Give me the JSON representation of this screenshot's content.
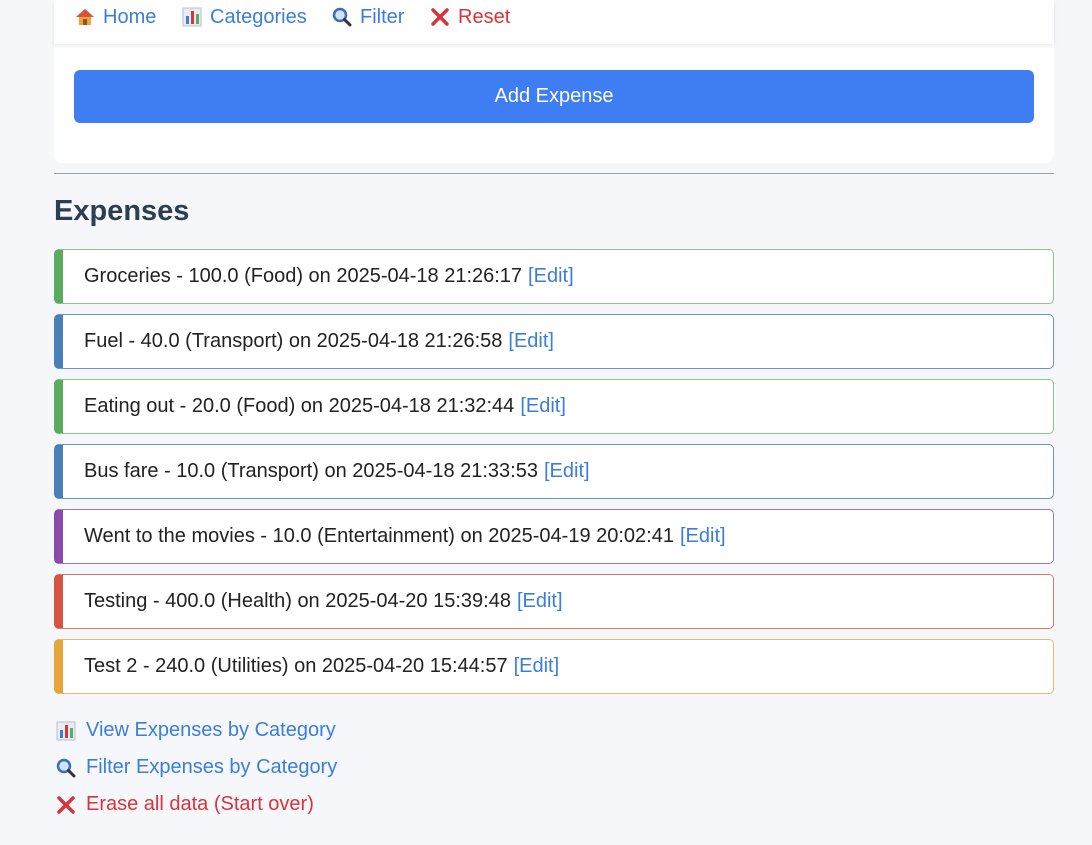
{
  "nav": {
    "items": [
      {
        "label": "Home",
        "icon": "house-icon",
        "color": "#3b7ddd"
      },
      {
        "label": "Categories",
        "icon": "bar-chart-icon",
        "color": "#3b7ddd"
      },
      {
        "label": "Filter",
        "icon": "magnifier-icon",
        "color": "#3b7ddd"
      },
      {
        "label": "Reset",
        "icon": "cross-icon",
        "color": "#d8343a"
      }
    ]
  },
  "add_button": {
    "label": "Add Expense",
    "color": "#3f7ef2"
  },
  "section": {
    "title": "Expenses"
  },
  "expenses": [
    {
      "text": "Groceries - 100.0 (Food) on 2025-04-18 21:26:17",
      "edit": "[Edit]",
      "category": "Food",
      "accent": "#5aab5e",
      "border": "#8cc58f"
    },
    {
      "text": "Fuel - 40.0 (Transport) on 2025-04-18 21:26:58",
      "edit": "[Edit]",
      "category": "Transport",
      "accent": "#4a7fba",
      "border": "#6b93c4"
    },
    {
      "text": "Eating out - 20.0 (Food) on 2025-04-18 21:32:44",
      "edit": "[Edit]",
      "category": "Food",
      "accent": "#5aab5e",
      "border": "#8cc58f"
    },
    {
      "text": "Bus fare - 10.0 (Transport) on 2025-04-18 21:33:53",
      "edit": "[Edit]",
      "category": "Transport",
      "accent": "#4a7fba",
      "border": "#6b93c4"
    },
    {
      "text": "Went to the movies - 10.0 (Entertainment) on 2025-04-19 20:02:41",
      "edit": "[Edit]",
      "category": "Entertainment",
      "accent": "#8a4aad",
      "border": "#a178be"
    },
    {
      "text": "Testing - 400.0 (Health) on 2025-04-20 15:39:48",
      "edit": "[Edit]",
      "category": "Health",
      "accent": "#d65443",
      "border": "#d8786c"
    },
    {
      "text": "Test 2 - 240.0 (Utilities) on 2025-04-20 15:44:57",
      "edit": "[Edit]",
      "category": "Utilities",
      "accent": "#e6a43a",
      "border": "#e5bb72"
    }
  ],
  "bottom_links": [
    {
      "label": "View Expenses by Category",
      "icon": "bar-chart-icon",
      "color": "#3b7ddd"
    },
    {
      "label": "Filter Expenses by Category",
      "icon": "magnifier-icon",
      "color": "#3b7ddd"
    },
    {
      "label": "Erase all data (Start over)",
      "icon": "cross-icon",
      "color": "#d8343a"
    }
  ]
}
